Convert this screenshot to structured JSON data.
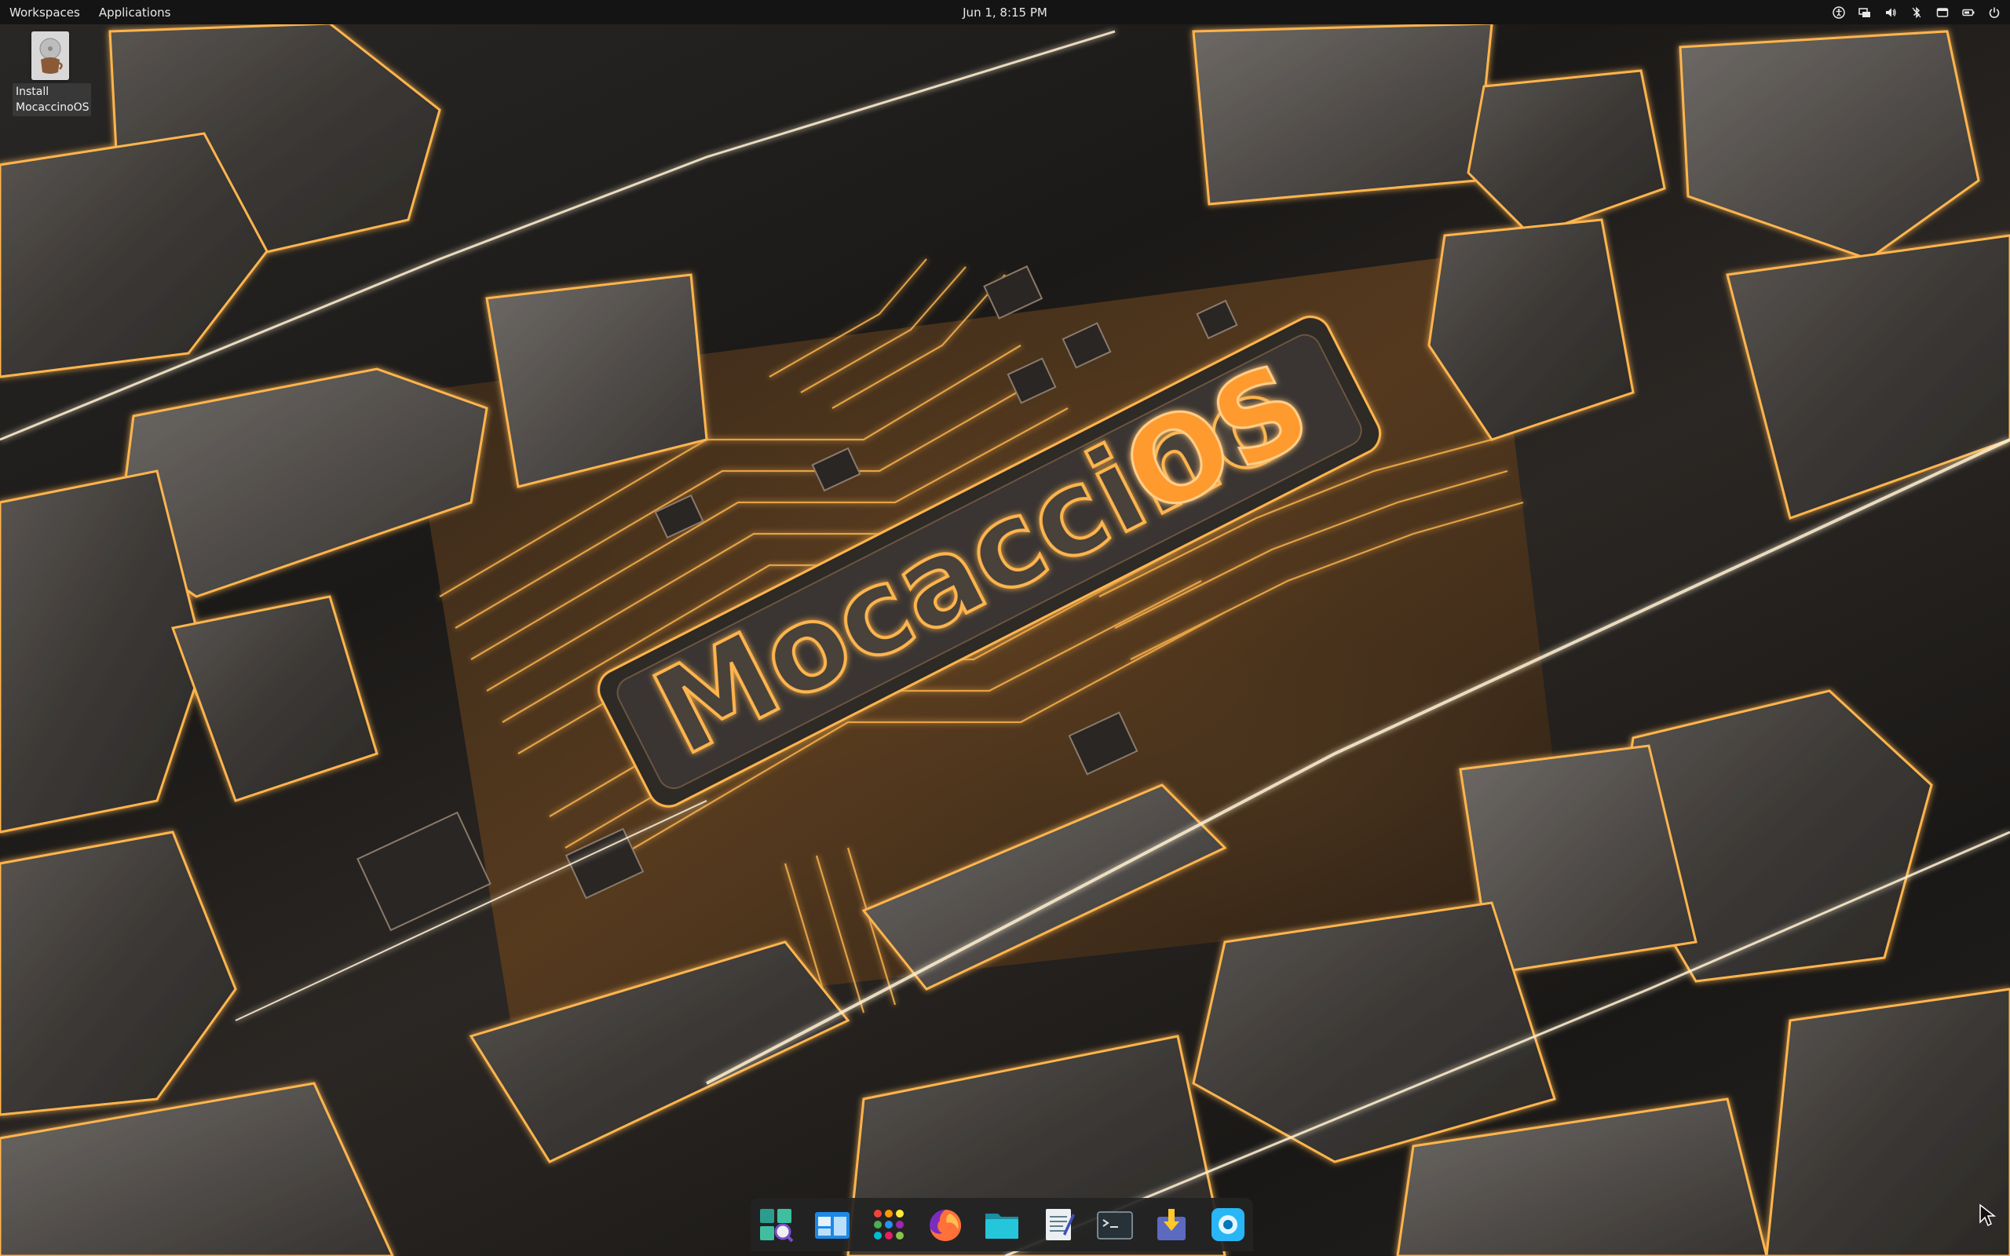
{
  "topbar": {
    "menus": [
      "Workspaces",
      "Applications"
    ],
    "clock": "Jun 1, 8:15 PM",
    "tray_icons": [
      "accessibility-icon",
      "network-icon",
      "volume-icon",
      "bluetooth-icon",
      "notifications-icon",
      "battery-icon",
      "power-icon"
    ]
  },
  "desktop_icons": [
    {
      "label": "Install MocaccinoOS",
      "icon": "installer-icon"
    }
  ],
  "wallpaper": {
    "logo_text_primary": "Mocaccino",
    "logo_text_accent": "OS",
    "accent_color": "#ff9a2e",
    "glow_color": "#ffb54d",
    "plate_color": "#3a3532"
  },
  "dock": {
    "apps": [
      {
        "name": "app-search-icon"
      },
      {
        "name": "window-overview-icon"
      },
      {
        "name": "app-grid-icon"
      },
      {
        "name": "firefox-icon"
      },
      {
        "name": "files-icon"
      },
      {
        "name": "text-editor-icon"
      },
      {
        "name": "terminal-icon"
      },
      {
        "name": "installer-icon"
      },
      {
        "name": "screenshot-icon"
      }
    ]
  }
}
